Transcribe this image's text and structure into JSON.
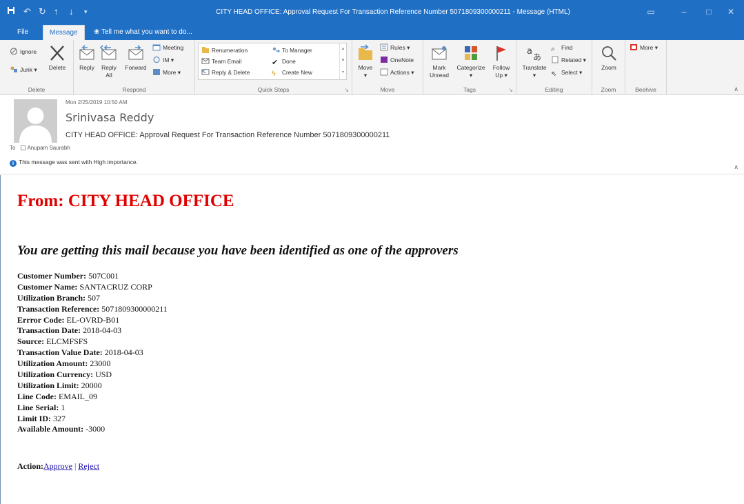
{
  "window": {
    "title": "CITY HEAD OFFICE: Approval Request For Transaction Reference Number 5071809300000211 - Message (HTML)"
  },
  "tabs": {
    "file": "File",
    "message": "Message",
    "tell_me": "Tell me what you want to do..."
  },
  "ribbon": {
    "delete_group": {
      "label": "Delete",
      "ignore": "Ignore",
      "junk": "Junk",
      "delete": "Delete"
    },
    "respond_group": {
      "label": "Respond",
      "reply": "Reply",
      "reply_all_1": "Reply",
      "reply_all_2": "All",
      "forward": "Forward",
      "meeting": "Meeting",
      "im": "IM",
      "more": "More"
    },
    "quick_steps": {
      "label": "Quick Steps",
      "items": [
        "Renumeration",
        "Team Email",
        "Reply & Delete",
        "To Manager",
        "Done",
        "Create New"
      ]
    },
    "move_group": {
      "label": "Move",
      "move": "Move",
      "rules": "Rules",
      "onenote": "OneNote",
      "actions": "Actions"
    },
    "tags_group": {
      "label": "Tags",
      "mark_unread_1": "Mark",
      "mark_unread_2": "Unread",
      "categorize": "Categorize",
      "follow_up_1": "Follow",
      "follow_up_2": "Up"
    },
    "editing_group": {
      "label": "Editing",
      "translate": "Translate",
      "find": "Find",
      "related": "Related",
      "select": "Select"
    },
    "zoom_group": {
      "label": "Zoom",
      "zoom": "Zoom"
    },
    "beehive_group": {
      "label": "Beehive",
      "more": "More"
    }
  },
  "message": {
    "date": "Mon 2/25/2019 10:50 AM",
    "sender": "Srinivasa Reddy",
    "subject": "CITY HEAD OFFICE: Approval Request For Transaction Reference Number 5071809300000211",
    "to_label": "To",
    "to_recipient": "Anupam Saurabh",
    "importance": "This message was sent with High importance."
  },
  "body": {
    "from_heading": "From: CITY HEAD OFFICE",
    "approvers_line": "You are getting this mail because you have been identified as one of the approvers",
    "fields": [
      {
        "label": "Customer Number:",
        "value": " 507C001"
      },
      {
        "label": "Customer Name:",
        "value": " SANTACRUZ CORP"
      },
      {
        "label": "Utilization Branch:",
        "value": " 507"
      },
      {
        "label": "Transaction Reference:",
        "value": " 5071809300000211"
      },
      {
        "label": "Errror Code:",
        "value": " EL-OVRD-B01"
      },
      {
        "label": "Transaction Date:",
        "value": " 2018-04-03"
      },
      {
        "label": "Source:",
        "value": " ELCMFSFS"
      },
      {
        "label": "Transaction Value Date:",
        "value": " 2018-04-03"
      },
      {
        "label": "Utilization Amount:",
        "value": " 23000"
      },
      {
        "label": "Utilization Currency:",
        "value": " USD"
      },
      {
        "label": "Utilization Limit:",
        "value": " 20000"
      },
      {
        "label": "Line Code:",
        "value": " EMAIL_09"
      },
      {
        "label": "Line Serial:",
        "value": " 1"
      },
      {
        "label": "Limit ID:",
        "value": " 327"
      },
      {
        "label": "Available Amount:",
        "value": " -3000"
      }
    ],
    "action_label": "Action:",
    "approve": "Approve",
    "reject": "Reject"
  }
}
